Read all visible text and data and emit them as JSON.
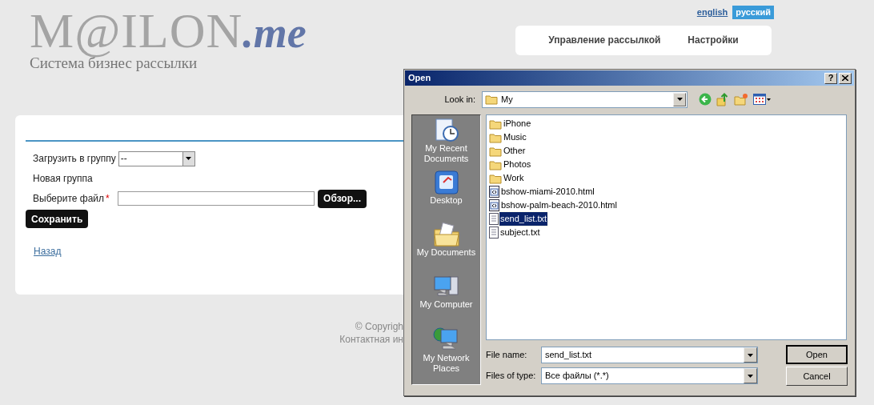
{
  "header": {
    "logo": {
      "main": "M@ILON",
      "suffix": ".me"
    },
    "tagline": "Система бизнес рассылки",
    "languages": [
      {
        "label": "english",
        "selected": false
      },
      {
        "label": "русский",
        "selected": true
      }
    ],
    "nav": [
      "Управление рассылкой",
      "Настройки"
    ]
  },
  "form": {
    "fields": [
      {
        "kind": "select",
        "label": "Загрузить в группу",
        "value": "--"
      },
      {
        "kind": "text",
        "label": "Новая группа"
      },
      {
        "kind": "file",
        "label": "Выберите файл",
        "required_mark": "*",
        "button": "Обзор..."
      }
    ],
    "save_button": "Сохранить",
    "back_link": "Назад"
  },
  "footer": [
    "© Copyrigh",
    "Контактная ин"
  ],
  "dialog": {
    "title": "Open",
    "help_button": "?",
    "look_in": {
      "label": "Look in:",
      "value": "My"
    },
    "places": [
      {
        "kind": "recent",
        "label": "My Recent Documents"
      },
      {
        "kind": "desktop",
        "label": "Desktop"
      },
      {
        "kind": "documents",
        "label": "My Documents"
      },
      {
        "kind": "computer",
        "label": "My Computer"
      },
      {
        "kind": "network",
        "label": "My Network Places"
      }
    ],
    "files": [
      {
        "kind": "folder",
        "name": "iPhone",
        "selected": false
      },
      {
        "kind": "folder",
        "name": "Music",
        "selected": false
      },
      {
        "kind": "folder",
        "name": "Other",
        "selected": false
      },
      {
        "kind": "folder",
        "name": "Photos",
        "selected": false
      },
      {
        "kind": "folder",
        "name": "Work",
        "selected": false
      },
      {
        "kind": "html",
        "name": "bshow-miami-2010.html",
        "selected": false
      },
      {
        "kind": "html",
        "name": "bshow-palm-beach-2010.html",
        "selected": false
      },
      {
        "kind": "text",
        "name": "send_list.txt",
        "selected": true
      },
      {
        "kind": "text",
        "name": "subject.txt",
        "selected": false
      }
    ],
    "file_name": {
      "label": "File name:",
      "value": "send_list.txt"
    },
    "file_type": {
      "label": "Files of type:",
      "value": "Все файлы (*.*)"
    },
    "buttons": [
      "Open",
      "Cancel"
    ]
  }
}
